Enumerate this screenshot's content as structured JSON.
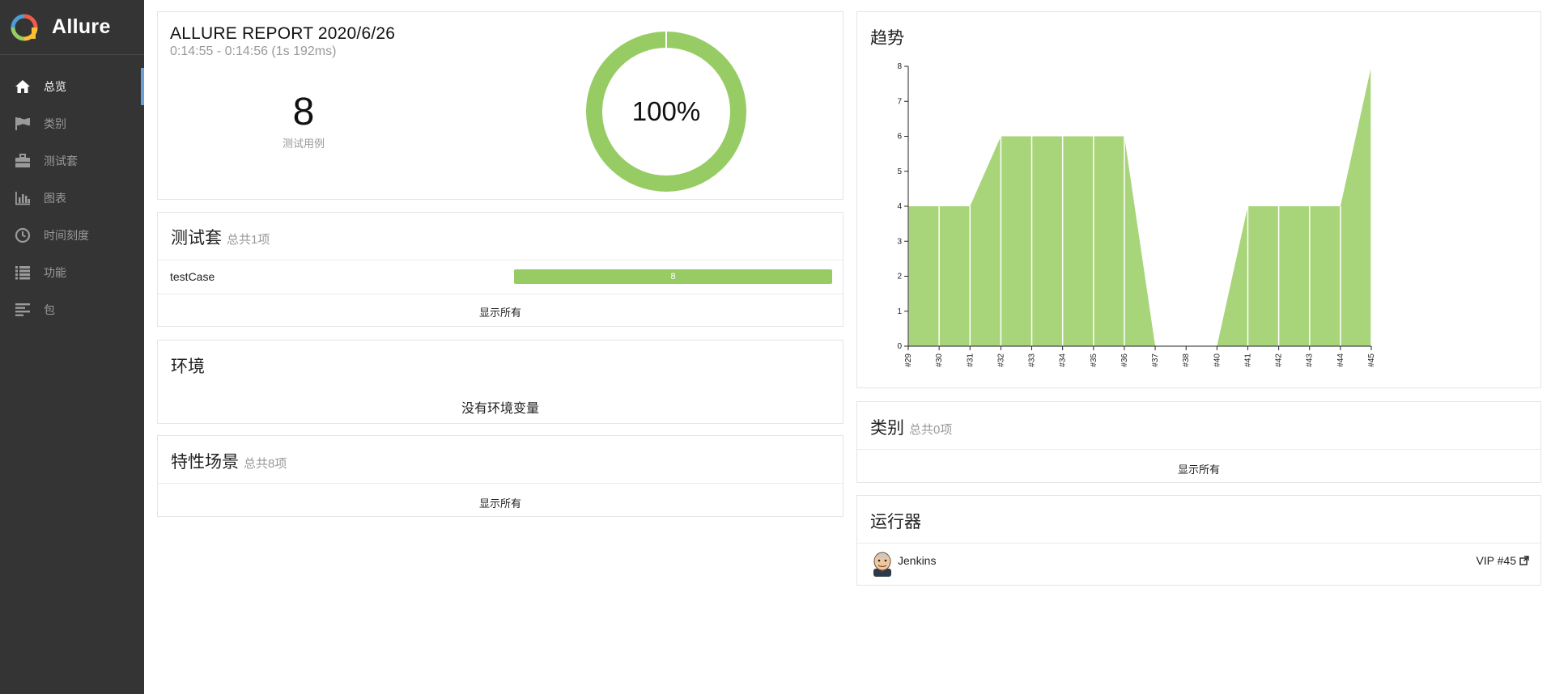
{
  "brand": {
    "name": "Allure"
  },
  "sidebar": {
    "items": [
      {
        "label": "总览",
        "icon": "home-icon",
        "active": true
      },
      {
        "label": "类别",
        "icon": "flag-icon",
        "active": false
      },
      {
        "label": "测试套",
        "icon": "briefcase-icon",
        "active": false
      },
      {
        "label": "图表",
        "icon": "bar-chart-icon",
        "active": false
      },
      {
        "label": "时间刻度",
        "icon": "clock-icon",
        "active": false
      },
      {
        "label": "功能",
        "icon": "list-icon",
        "active": false
      },
      {
        "label": "包",
        "icon": "align-left-icon",
        "active": false
      }
    ]
  },
  "summary": {
    "title": "ALLURE REPORT 2020/6/26",
    "time": "0:14:55 - 0:14:56 (1s 192ms)",
    "count": "8",
    "count_label": "测试用例",
    "percent": "100%",
    "pass_fraction": 1.0,
    "pass_color": "#97cc64"
  },
  "suites": {
    "title": "测试套",
    "count": "总共1项",
    "rows": [
      {
        "name": "testCase",
        "passed": "8"
      }
    ],
    "show_all": "显示所有"
  },
  "environment": {
    "title": "环境",
    "empty": "没有环境变量"
  },
  "features": {
    "title": "特性场景",
    "count": "总共8项",
    "show_all": "显示所有"
  },
  "trend": {
    "title": "趋势"
  },
  "chart_data": {
    "type": "area",
    "title": "趋势",
    "x": [
      "#29",
      "#30",
      "#31",
      "#32",
      "#33",
      "#34",
      "#35",
      "#36",
      "#37",
      "#38",
      "#40",
      "#41",
      "#42",
      "#43",
      "#44",
      "#45"
    ],
    "series": [
      {
        "values": [
          4,
          4,
          4,
          6,
          6,
          6,
          6,
          6,
          0,
          0,
          0,
          4,
          4,
          4,
          4,
          8
        ],
        "color": "#a8d57a"
      }
    ],
    "ylim": [
      0,
      8
    ],
    "yticks": [
      "0",
      "1",
      "2",
      "3",
      "4",
      "5",
      "6",
      "7",
      "8"
    ],
    "grid": false
  },
  "categories": {
    "title": "类别",
    "count": "总共0项",
    "show_all": "显示所有"
  },
  "executors": {
    "title": "运行器",
    "name": "Jenkins",
    "build": "VIP #45"
  }
}
